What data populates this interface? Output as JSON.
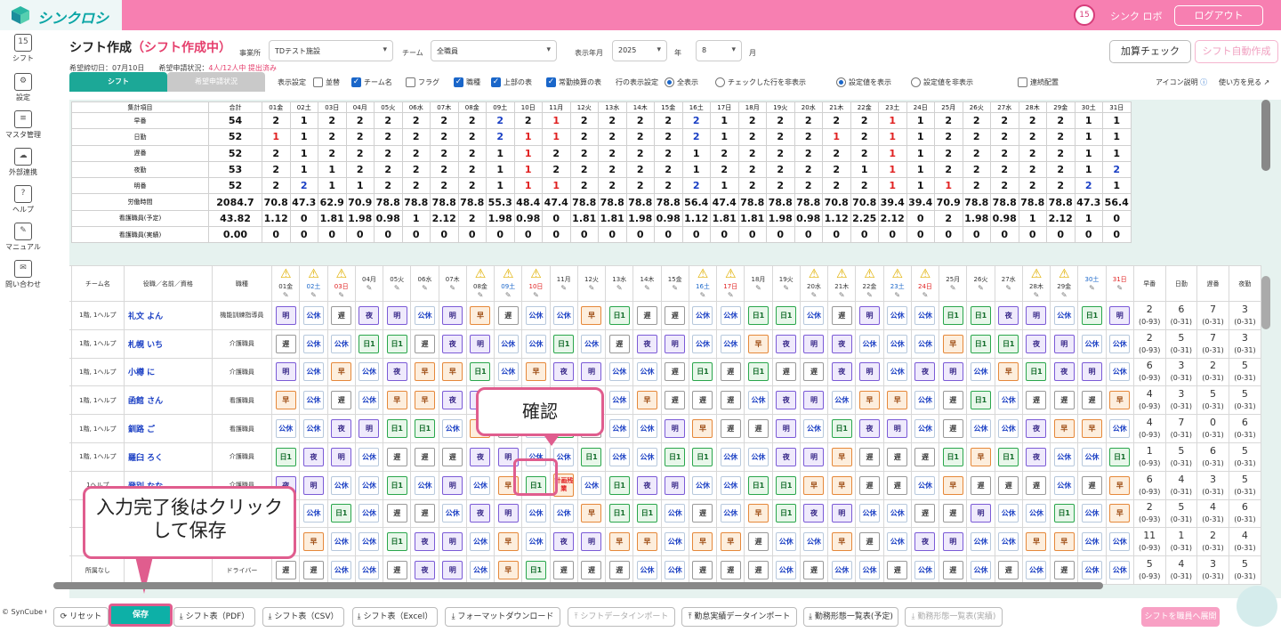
{
  "app": {
    "title": "シンクロシフト",
    "calendar_day": "15",
    "user": "シンク ロボ",
    "logout": "ログアウト"
  },
  "sidebar": [
    {
      "label": "シフト",
      "icon": "calendar-icon",
      "glyph": "15"
    },
    {
      "label": "設定",
      "icon": "gear-icon",
      "glyph": "⚙"
    },
    {
      "label": "マスタ管理",
      "icon": "database-icon",
      "glyph": "≡"
    },
    {
      "label": "外部連携",
      "icon": "cloud-icon",
      "glyph": "☁"
    },
    {
      "label": "ヘルプ",
      "icon": "help-icon",
      "glyph": "?"
    },
    {
      "label": "マニュアル",
      "icon": "manual-icon",
      "glyph": "✎"
    },
    {
      "label": "問い合わせ",
      "icon": "mail-icon",
      "glyph": "✉"
    }
  ],
  "copyright": "© SynCube Co., Ltd.",
  "header": {
    "title": "シフト作成",
    "title_sub": "（シフト作成中）",
    "office_label": "事業所",
    "office_value": "TDテスト施設",
    "team_label": "チーム",
    "team_value": "全職員",
    "year_label": "表示年月",
    "year_value": "2025",
    "year_unit": "年",
    "month_value": "8",
    "month_unit": "月",
    "deadline_text": "希望締切日：07月10日　　希望申請状況：",
    "deadline_status": "4人/12人中 提出済み",
    "check_button": "加算チェック",
    "auto_button": "シフト自動作成"
  },
  "tabs": {
    "shift": "シフト",
    "request": "希望申請状況"
  },
  "options": {
    "display_label": "表示設定",
    "checks": [
      {
        "label": "並替",
        "on": false
      },
      {
        "label": "チーム名",
        "on": true
      },
      {
        "label": "フラグ",
        "on": false
      },
      {
        "label": "職種",
        "on": true
      },
      {
        "label": "上部の表",
        "on": true
      },
      {
        "label": "常勤換算の表",
        "on": true
      }
    ],
    "row_label": "行の表示設定",
    "radios1": [
      {
        "label": "全表示",
        "on": true
      },
      {
        "label": "チェックした行を非表示",
        "on": false
      }
    ],
    "radios2": [
      {
        "label": "設定値を表示",
        "on": true
      },
      {
        "label": "設定値を非表示",
        "on": false
      }
    ],
    "consecutive": "連続配置",
    "icon_help": "アイコン説明",
    "how_to": "使い方を見る"
  },
  "days": [
    "01金",
    "02土",
    "03日",
    "04月",
    "05火",
    "06水",
    "07木",
    "08金",
    "09土",
    "10日",
    "11月",
    "12火",
    "13水",
    "14木",
    "15金",
    "16土",
    "17日",
    "18月",
    "19火",
    "20水",
    "21木",
    "22金",
    "23土",
    "24日",
    "25月",
    "26火",
    "27水",
    "28木",
    "29金",
    "30土",
    "31日"
  ],
  "summary": {
    "header_label": "集計項目",
    "total_label": "合計",
    "rows": [
      {
        "label": "早番",
        "total": "54",
        "vals": [
          "2",
          "1",
          "2",
          "2",
          "2",
          "2",
          "2",
          "2",
          "2",
          "2",
          "1",
          "2",
          "2",
          "2",
          "2",
          "2",
          "1",
          "2",
          "2",
          "2",
          "2",
          "2",
          "1",
          "1",
          "2",
          "2",
          "2",
          "2",
          "2",
          "1",
          "1"
        ]
      },
      {
        "label": "日勤",
        "total": "52",
        "vals": [
          "1",
          "1",
          "2",
          "2",
          "2",
          "2",
          "2",
          "2",
          "2",
          "1",
          "1",
          "2",
          "2",
          "2",
          "2",
          "2",
          "1",
          "2",
          "2",
          "2",
          "1",
          "2",
          "1",
          "1",
          "2",
          "2",
          "2",
          "2",
          "2",
          "1",
          "1"
        ]
      },
      {
        "label": "遅番",
        "total": "52",
        "vals": [
          "2",
          "1",
          "2",
          "2",
          "2",
          "2",
          "2",
          "2",
          "1",
          "1",
          "2",
          "2",
          "2",
          "2",
          "2",
          "1",
          "2",
          "2",
          "2",
          "2",
          "2",
          "2",
          "1",
          "1",
          "2",
          "2",
          "2",
          "2",
          "2",
          "1",
          "1"
        ]
      },
      {
        "label": "夜勤",
        "total": "53",
        "vals": [
          "2",
          "1",
          "1",
          "2",
          "2",
          "2",
          "2",
          "2",
          "1",
          "1",
          "2",
          "2",
          "2",
          "2",
          "2",
          "1",
          "2",
          "2",
          "2",
          "2",
          "2",
          "1",
          "1",
          "1",
          "2",
          "2",
          "2",
          "2",
          "2",
          "1",
          "2"
        ]
      },
      {
        "label": "明番",
        "total": "52",
        "vals": [
          "2",
          "2",
          "1",
          "1",
          "2",
          "2",
          "2",
          "2",
          "1",
          "1",
          "1",
          "2",
          "2",
          "2",
          "2",
          "2",
          "1",
          "2",
          "2",
          "2",
          "2",
          "2",
          "1",
          "1",
          "1",
          "2",
          "2",
          "2",
          "2",
          "2",
          "1"
        ]
      },
      {
        "label": "労働時間",
        "total": "2084.7",
        "vals": [
          "70.8",
          "47.3",
          "62.9",
          "70.9",
          "78.8",
          "78.8",
          "78.8",
          "78.8",
          "55.3",
          "48.4",
          "47.4",
          "78.8",
          "78.8",
          "78.8",
          "78.8",
          "56.4",
          "47.4",
          "78.8",
          "78.8",
          "78.8",
          "70.8",
          "70.8",
          "39.4",
          "39.4",
          "70.9",
          "78.8",
          "78.8",
          "78.8",
          "78.8",
          "47.3",
          "56.4"
        ]
      },
      {
        "label": "看護職員(予定)",
        "total": "43.82",
        "vals": [
          "1.12",
          "0",
          "1.81",
          "1.98",
          "0.98",
          "1",
          "2.12",
          "2",
          "1.98",
          "0.98",
          "0",
          "1.81",
          "1.81",
          "1.98",
          "0.98",
          "1.12",
          "1.81",
          "1.81",
          "1.98",
          "0.98",
          "1.12",
          "2.25",
          "2.12",
          "0",
          "2",
          "1.98",
          "0.98",
          "1",
          "2.12",
          "1",
          "0"
        ]
      },
      {
        "label": "看護職員(実績)",
        "total": "0.00",
        "vals": [
          "0",
          "0",
          "0",
          "0",
          "0",
          "0",
          "0",
          "0",
          "0",
          "0",
          "0",
          "0",
          "0",
          "0",
          "0",
          "0",
          "0",
          "0",
          "0",
          "0",
          "0",
          "0",
          "0",
          "0",
          "0",
          "0",
          "0",
          "0",
          "0",
          "0",
          "0"
        ]
      }
    ]
  },
  "table": {
    "headers": {
      "team": "チーム名",
      "name": "役職／名前／資格",
      "role": "職種"
    },
    "stat_headers": [
      "早番",
      "日勤",
      "遅番",
      "夜勤"
    ],
    "stat_range": "(0-93)",
    "stat_range_other": "(0-31)",
    "warn_days": [
      1,
      2,
      3,
      8,
      9,
      10,
      16,
      17,
      20,
      21,
      22,
      23,
      24,
      28,
      29
    ],
    "rows": [
      {
        "team": "1階, 1ヘルプ",
        "name": "礼文 よん",
        "role": "機能訓練指導員",
        "shifts": [
          "明",
          "公休",
          "遅",
          "夜",
          "明",
          "公休",
          "明",
          "早",
          "遅",
          "公休",
          "公休",
          "早",
          "日1",
          "遅",
          "遅",
          "公休",
          "公休",
          "日1",
          "日1",
          "公休",
          "遅",
          "明",
          "公休",
          "公休",
          "日1",
          "日1",
          "夜",
          "明",
          "公休",
          "日1",
          "明"
        ],
        "stats": [
          "2",
          "6",
          "7",
          "3"
        ]
      },
      {
        "team": "1階, 1ヘルプ",
        "name": "札幌 いち",
        "role": "介護職員",
        "shifts": [
          "遅",
          "公休",
          "公休",
          "日1",
          "日1",
          "遅",
          "夜",
          "明",
          "公休",
          "公休",
          "日1",
          "公休",
          "遅",
          "夜",
          "明",
          "公休",
          "公休",
          "早",
          "夜",
          "明",
          "夜",
          "公休",
          "公休",
          "公休",
          "早",
          "日1",
          "日1",
          "夜",
          "明",
          "公休",
          "公休"
        ],
        "stats": [
          "2",
          "5",
          "7",
          "3"
        ]
      },
      {
        "team": "1階, 1ヘルプ",
        "name": "小樽 に",
        "role": "介護職員",
        "shifts": [
          "明",
          "公休",
          "早",
          "公休",
          "夜",
          "早",
          "早",
          "日1",
          "公休",
          "早",
          "夜",
          "明",
          "公休",
          "公休",
          "遅",
          "日1",
          "遅",
          "日1",
          "遅",
          "遅",
          "夜",
          "明",
          "公休",
          "夜",
          "明",
          "公休",
          "早",
          "日1",
          "夜",
          "明",
          "公休"
        ],
        "stats": [
          "6",
          "3",
          "2",
          "5"
        ]
      },
      {
        "team": "1階, 1ヘルプ",
        "name": "函館 さん",
        "role": "看護職員",
        "shifts": [
          "早",
          "公休",
          "遅",
          "公休",
          "早",
          "早",
          "夜",
          "明",
          "公休",
          "公休",
          "公休",
          "公休",
          "公休",
          "早",
          "遅",
          "遅",
          "遅",
          "公休",
          "夜",
          "明",
          "公休",
          "早",
          "早",
          "公休",
          "遅",
          "日1",
          "公休",
          "遅",
          "遅",
          "遅",
          "早"
        ],
        "stats": [
          "4",
          "3",
          "5",
          "5"
        ]
      },
      {
        "team": "1階, 1ヘルプ",
        "name": "釧路 ご",
        "role": "看護職員",
        "shifts": [
          "公休",
          "公休",
          "夜",
          "明",
          "日1",
          "日1",
          "公休",
          "早",
          "遅",
          "公休",
          "日1",
          "遅",
          "公休",
          "公休",
          "明",
          "早",
          "遅",
          "遅",
          "明",
          "公休",
          "日1",
          "夜",
          "明",
          "公休",
          "遅",
          "公休",
          "公休",
          "夜",
          "早",
          "早",
          "公休"
        ],
        "stats": [
          "4",
          "7",
          "0",
          "6"
        ]
      },
      {
        "team": "1階, 1ヘルプ",
        "name": "羅臼 ろく",
        "role": "介護職員",
        "shifts": [
          "日1",
          "夜",
          "明",
          "公休",
          "遅",
          "遅",
          "遅",
          "夜",
          "明",
          "公休",
          "公休",
          "日1",
          "公休",
          "公休",
          "日1",
          "日1",
          "公休",
          "公休",
          "夜",
          "明",
          "早",
          "遅",
          "遅",
          "遅",
          "日1",
          "早",
          "日1",
          "夜",
          "公休",
          "公休",
          "日1"
        ],
        "stats": [
          "1",
          "5",
          "6",
          "5"
        ]
      },
      {
        "team": "1ヘルプ",
        "name": "登別 なな",
        "role": "介護職員",
        "shifts": [
          "夜",
          "明",
          "公休",
          "公休",
          "日1",
          "公休",
          "明",
          "公休",
          "早",
          "日1",
          "計画残業",
          "公休",
          "日1",
          "夜",
          "明",
          "公休",
          "公休",
          "日1",
          "日1",
          "早",
          "早",
          "遅",
          "遅",
          "公休",
          "早",
          "遅",
          "遅",
          "遅",
          "公休",
          "遅",
          "早"
        ],
        "stats": [
          "6",
          "4",
          "3",
          "5"
        ]
      },
      {
        "team": "",
        "name": "",
        "role": "",
        "shifts": [
          "早",
          "公休",
          "日1",
          "公休",
          "遅",
          "遅",
          "公休",
          "夜",
          "明",
          "公休",
          "公休",
          "早",
          "日1",
          "日1",
          "公休",
          "遅",
          "公休",
          "早",
          "日1",
          "夜",
          "明",
          "公休",
          "公休",
          "遅",
          "遅",
          "明",
          "公休",
          "公休",
          "日1",
          "公休",
          "早"
        ],
        "stats": [
          "2",
          "5",
          "4",
          "6"
        ]
      },
      {
        "team": "",
        "name": "",
        "role": "",
        "shifts": [
          "早",
          "早",
          "公休",
          "公休",
          "日1",
          "夜",
          "明",
          "公休",
          "早",
          "公休",
          "夜",
          "明",
          "早",
          "早",
          "公休",
          "早",
          "早",
          "遅",
          "公休",
          "公休",
          "早",
          "遅",
          "公休",
          "夜",
          "明",
          "公休",
          "公休",
          "早",
          "早",
          "公休",
          "公休"
        ],
        "stats": [
          "11",
          "1",
          "2",
          "4"
        ]
      },
      {
        "team": "所属なし",
        "name": "",
        "role": "ドライバー",
        "shifts": [
          "遅",
          "遅",
          "公休",
          "公休",
          "遅",
          "夜",
          "明",
          "公休",
          "早",
          "日1",
          "遅",
          "遅",
          "遅",
          "公休",
          "公休",
          "遅",
          "遅",
          "遅",
          "公休",
          "遅",
          "公休",
          "公休",
          "遅",
          "公休",
          "遅",
          "公休",
          "遅",
          "公休",
          "遅",
          "公休",
          "公休"
        ],
        "stats": [
          "5",
          "4",
          "3",
          "5"
        ]
      }
    ]
  },
  "callouts": {
    "confirm": "確認",
    "save": "入力完了後はクリックして保存"
  },
  "bottom": {
    "reset": "リセット",
    "save": "保存",
    "pdf": "シフト表（PDF）",
    "csv": "シフト表（CSV）",
    "excel": "シフト表（Excel）",
    "format_dl": "フォーマットダウンロード",
    "shift_import": "シフトデータインポート",
    "attendance_import": "勤怠実績データインポート",
    "work_plan": "勤務形態一覧表(予定)",
    "work_actual": "勤務形態一覧表(実績)",
    "deploy": "シフトを職員へ展開"
  }
}
